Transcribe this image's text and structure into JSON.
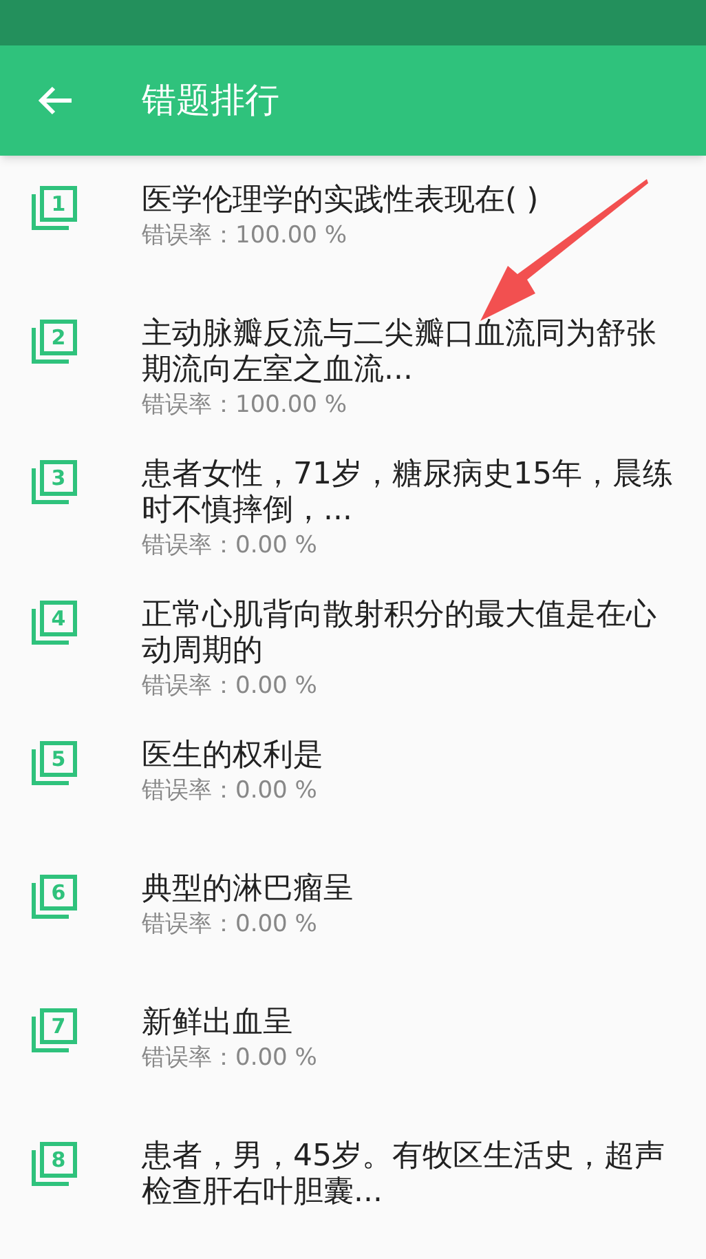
{
  "toolbar": {
    "title": "错题排行"
  },
  "items": [
    {
      "rank": "1",
      "question": "医学伦理学的实践性表现在(    )",
      "rate": "错误率：100.00 %"
    },
    {
      "rank": "2",
      "question": "主动脉瓣反流与二尖瓣口血流同为舒张期流向左室之血流...",
      "rate": "错误率：100.00 %"
    },
    {
      "rank": "3",
      "question": "患者女性，71岁，糖尿病史15年，晨练时不慎摔倒，...",
      "rate": "错误率：0.00 %"
    },
    {
      "rank": "4",
      "question": "正常心肌背向散射积分的最大值是在心动周期的",
      "rate": "错误率：0.00 %"
    },
    {
      "rank": "5",
      "question": "医生的权利是",
      "rate": "错误率：0.00 %"
    },
    {
      "rank": "6",
      "question": "典型的淋巴瘤呈",
      "rate": "错误率：0.00 %"
    },
    {
      "rank": "7",
      "question": "新鲜出血呈",
      "rate": "错误率：0.00 %"
    },
    {
      "rank": "8",
      "question": "患者，男，45岁。有牧区生活史，超声检查肝右叶胆囊..."
    }
  ],
  "annotation": {
    "kind": "arrow"
  }
}
